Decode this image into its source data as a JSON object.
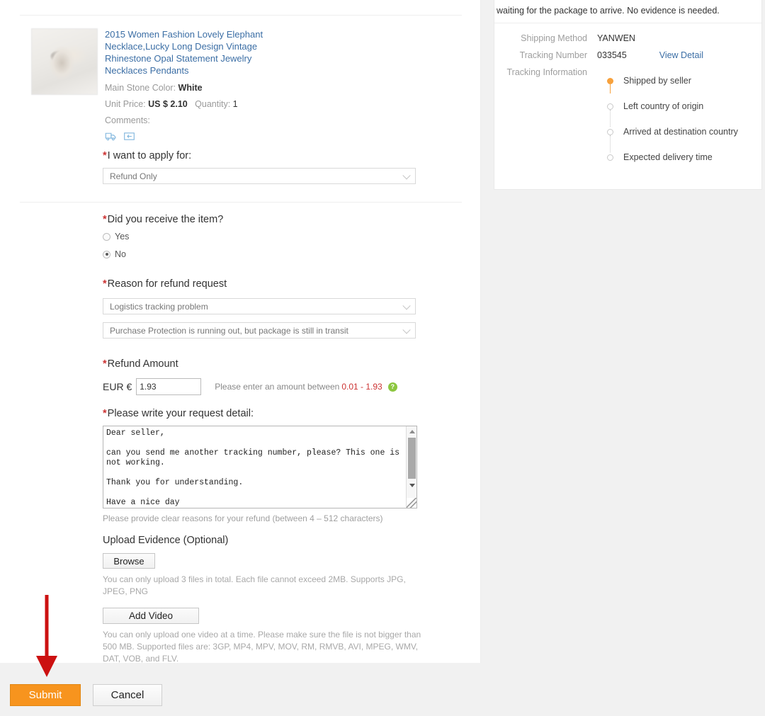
{
  "product": {
    "title": "2015 Women Fashion Lovely Elephant Necklace,Lucky Long Design Vintage Rhinestone Opal Statement Jewelry Necklaces Pendants",
    "stone_color_label": "Main Stone Color:",
    "stone_color_value": "White",
    "unit_price_label": "Unit Price:",
    "unit_price_value": "US $ 2.10",
    "quantity_label": "Quantity:",
    "quantity_value": "1",
    "comments_label": "Comments:",
    "icons": [
      "shipping-truck-icon",
      "return-box-icon"
    ]
  },
  "apply_for": {
    "label": "I want to apply for:",
    "required_mark": "*",
    "selected": "Refund Only"
  },
  "received_item": {
    "label": "Did you receive the item?",
    "required_mark": "*",
    "options": [
      {
        "label": "Yes",
        "checked": false
      },
      {
        "label": "No",
        "checked": true
      }
    ]
  },
  "reason": {
    "label": "Reason for refund request",
    "required_mark": "*",
    "primary_selected": "Logistics tracking problem",
    "secondary_selected": "Purchase Protection is running out, but package is still in transit"
  },
  "refund_amount": {
    "label": "Refund Amount",
    "required_mark": "*",
    "currency": "EUR €",
    "value": "1.93",
    "hint_prefix": "Please enter an amount between",
    "hint_range": "0.01 - 1.93",
    "help_glyph": "?"
  },
  "request_detail": {
    "label": "Please write your request detail:",
    "required_mark": "*",
    "value": "Dear seller,\n\ncan you send me another tracking number, please? This one is not working.\n\nThank you for understanding.\n\nHave a nice day",
    "hint": "Please provide clear reasons for your refund (between 4 – 512 characters)"
  },
  "upload": {
    "title": "Upload Evidence (Optional)",
    "browse_label": "Browse",
    "browse_note": "You can only upload 3 files in total. Each file cannot exceed 2MB. Supports JPG, JPEG, PNG",
    "add_video_label": "Add Video",
    "video_note": "You can only upload one video at a time. Please make sure the file is not bigger than 500 MB. Supported files are: 3GP, MP4, MPV, MOV, RM, RMVB, AVI, MPEG, WMV, DAT, VOB, and FLV."
  },
  "footer": {
    "submit_label": "Submit",
    "cancel_label": "Cancel"
  },
  "annotation": {
    "arrow": "red-down-arrow",
    "color": "#cc1111"
  },
  "right_panel": {
    "note": "waiting for the package to arrive. No evidence is needed.",
    "shipping_method_label": "Shipping Method",
    "shipping_method_value": "YANWEN",
    "tracking_number_label": "Tracking Number",
    "tracking_number_value": "033545",
    "view_detail_label": "View Detail",
    "tracking_info_label": "Tracking Information",
    "timeline": [
      {
        "label": "Shipped by seller",
        "active": true
      },
      {
        "label": "Left country of origin",
        "active": false
      },
      {
        "label": "Arrived at destination country",
        "active": false
      },
      {
        "label": "Expected delivery time",
        "active": false
      }
    ]
  },
  "colors": {
    "accent_orange": "#f7941e",
    "link_blue": "#3b6ea5",
    "required_red": "#cc3333",
    "help_green": "#8cc63f",
    "page_bg": "#f1f1f1"
  }
}
